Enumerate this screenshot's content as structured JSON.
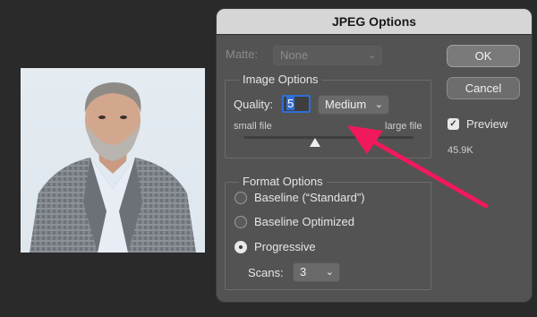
{
  "dialog": {
    "title": "JPEG Options",
    "matte": {
      "label": "Matte:",
      "value": "None"
    },
    "image_options": {
      "title": "Image Options",
      "quality_label": "Quality:",
      "quality_value": "5",
      "quality_preset": "Medium",
      "small_label": "small file",
      "large_label": "large file",
      "slider_fraction": 0.42
    },
    "format_options": {
      "title": "Format Options",
      "options": [
        "Baseline (“Standard”)",
        "Baseline Optimized",
        "Progressive"
      ],
      "selected": "Progressive",
      "scans_label": "Scans:",
      "scans_value": "3"
    },
    "buttons": {
      "ok": "OK",
      "cancel": "Cancel"
    },
    "preview": {
      "label": "Preview",
      "checked": true,
      "file_size": "45.9K"
    }
  },
  "colors": {
    "annotation_arrow": "#f0195c",
    "field_focus": "#2f6fd6"
  }
}
